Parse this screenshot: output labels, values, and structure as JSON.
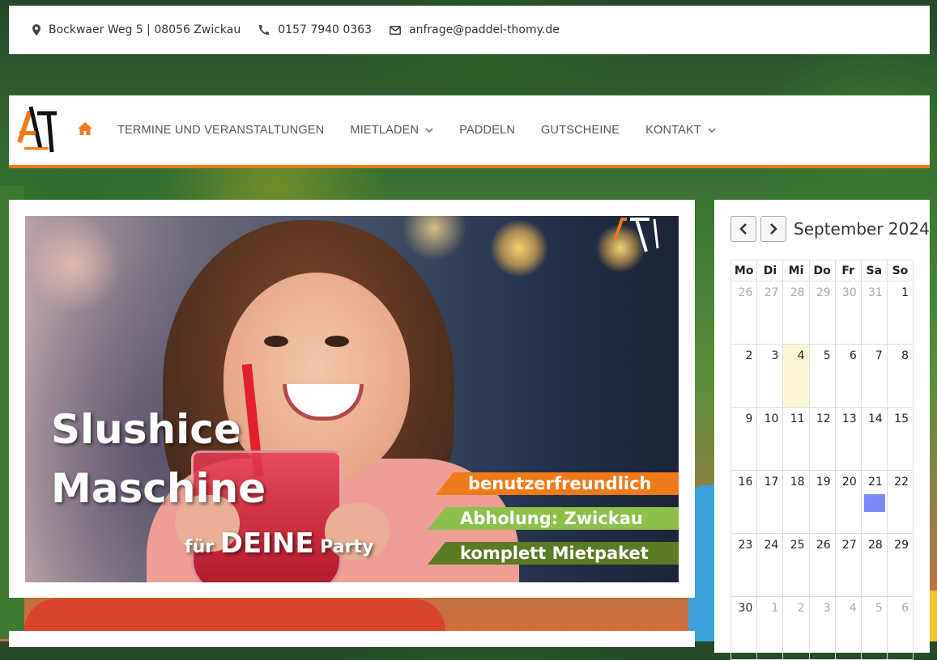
{
  "topbar": {
    "address": "Bockwaer Weg 5 | 08056 Zwickau",
    "phone": "0157 7940 0363",
    "email": "anfrage@paddel-thomy.de"
  },
  "nav": {
    "items": [
      {
        "label": "TERMINE UND VERANSTALTUNGEN",
        "dropdown": false
      },
      {
        "label": "MIETLADEN",
        "dropdown": true
      },
      {
        "label": "PADDELN",
        "dropdown": false
      },
      {
        "label": "GUTSCHEINE",
        "dropdown": false
      },
      {
        "label": "KONTAKT",
        "dropdown": true
      }
    ],
    "accent": "#ef7a1a"
  },
  "banner": {
    "title_line1": "Slushice",
    "title_line2": "Maschine",
    "sub_pre": "für",
    "sub_big": "DEINE",
    "sub_post": "Party",
    "ribbons": [
      "benutzerfreundlich",
      "Abholung: Zwickau",
      "komplett Mietpaket"
    ]
  },
  "calendar": {
    "month_label": "September 2024",
    "weekdays": [
      "Mo",
      "Di",
      "Mi",
      "Do",
      "Fr",
      "Sa",
      "So"
    ],
    "weeks": [
      [
        "26",
        "27",
        "28",
        "29",
        "30",
        "31",
        "1"
      ],
      [
        "2",
        "3",
        "4",
        "5",
        "6",
        "7",
        "8"
      ],
      [
        "9",
        "10",
        "11",
        "12",
        "13",
        "14",
        "15"
      ],
      [
        "16",
        "17",
        "18",
        "19",
        "20",
        "21",
        "22"
      ],
      [
        "23",
        "24",
        "25",
        "26",
        "27",
        "28",
        "29"
      ],
      [
        "30",
        "1",
        "2",
        "3",
        "4",
        "5",
        "6"
      ]
    ],
    "today": "4",
    "event_day": "21",
    "event_color": "#7b8af7"
  }
}
